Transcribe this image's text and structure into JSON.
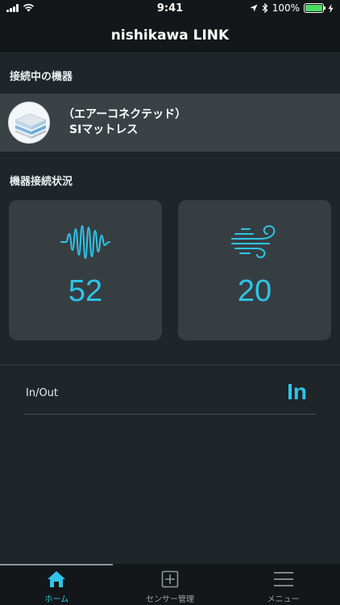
{
  "status_bar": {
    "time": "9:41",
    "battery_percent": "100%",
    "battery_level": 1.0
  },
  "nav": {
    "title": "nishikawa LINK"
  },
  "connected_section": {
    "header": "接続中の機器"
  },
  "device": {
    "line1": "（エアーコネクテッド）",
    "line2": "SIマットレス"
  },
  "status_section": {
    "header": "機器接続状況"
  },
  "cards": [
    {
      "icon": "waveform-icon",
      "value": "52"
    },
    {
      "icon": "wind-icon",
      "value": "20"
    }
  ],
  "inout": {
    "label": "In/Out",
    "value": "In"
  },
  "tabs": [
    {
      "label": "ホーム",
      "icon": "home-icon",
      "active": true
    },
    {
      "label": "センサー管理",
      "icon": "plus-square-icon",
      "active": false
    },
    {
      "label": "メニュー",
      "icon": "menu-icon",
      "active": false
    }
  ],
  "colors": {
    "accent": "#2fc4e8",
    "background": "#1f2528",
    "card": "#363e42",
    "device_row": "#3a4246",
    "bar": "#131719"
  }
}
